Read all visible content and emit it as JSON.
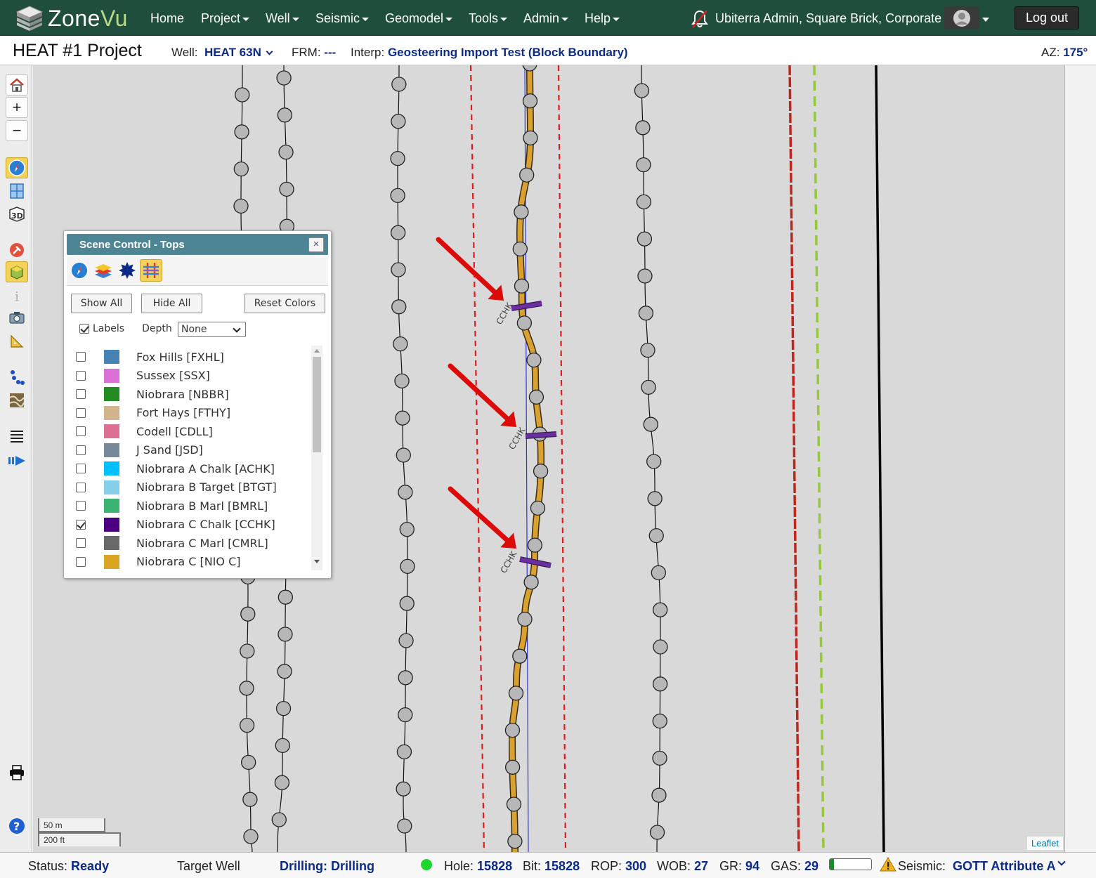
{
  "app": {
    "brand_zone": "Zone",
    "brand_vu": "Vu"
  },
  "nav": {
    "items": [
      {
        "label": "Home",
        "caret": false
      },
      {
        "label": "Project",
        "caret": true
      },
      {
        "label": "Well",
        "caret": true
      },
      {
        "label": "Seismic",
        "caret": true
      },
      {
        "label": "Geomodel",
        "caret": true
      },
      {
        "label": "Tools",
        "caret": true
      },
      {
        "label": "Admin",
        "caret": true
      },
      {
        "label": "Help",
        "caret": true
      }
    ],
    "user": "Ubiterra Admin, Square Brick, Corporate",
    "logout": "Log out"
  },
  "project": {
    "title": "HEAT #1 Project",
    "well_label": "Well:",
    "well_value": "HEAT 63N",
    "frm_label": "FRM:",
    "frm_value": "---",
    "interp_label": "Interp:",
    "interp_value": "Geosteering Import Test (Block Boundary)",
    "az_label": "AZ:",
    "az_value": "175°"
  },
  "scene_control": {
    "title": "Scene Control - Tops",
    "close_glyph": "×",
    "show_all": "Show All",
    "hide_all": "Hide All",
    "reset_colors": "Reset Colors",
    "labels_text": "Labels",
    "labels_checked": true,
    "depth_label": "Depth",
    "depth_value": "None",
    "tops": [
      {
        "name": "Fox Hills [FXHL]",
        "color": "#4682b4",
        "checked": false
      },
      {
        "name": "Sussex [SSX]",
        "color": "#da70d6",
        "checked": false
      },
      {
        "name": "Niobrara [NBBR]",
        "color": "#228b22",
        "checked": false
      },
      {
        "name": "Fort Hays [FTHY]",
        "color": "#d2b48c",
        "checked": false
      },
      {
        "name": "Codell [CDLL]",
        "color": "#db7093",
        "checked": false
      },
      {
        "name": "J Sand [JSD]",
        "color": "#778899",
        "checked": false
      },
      {
        "name": "Niobrara A Chalk [ACHK]",
        "color": "#00bfff",
        "checked": false
      },
      {
        "name": "Niobrara B Target [BTGT]",
        "color": "#87ceeb",
        "checked": false
      },
      {
        "name": "Niobrara B Marl [BMRL]",
        "color": "#3cb371",
        "checked": false
      },
      {
        "name": "Niobrara C Chalk [CCHK]",
        "color": "#4b0082",
        "checked": true
      },
      {
        "name": "Niobrara C Marl [CMRL]",
        "color": "#696969",
        "checked": false
      },
      {
        "name": "Niobrara C [NIO C]",
        "color": "#daa520",
        "checked": false
      }
    ]
  },
  "map": {
    "top_label": "CCHK",
    "pick_color": "#6a2f9e",
    "wellbore_color": "#d9a230",
    "arrow_color": "#dd0a0a",
    "scale_m": "50 m",
    "scale_ft": "200 ft",
    "attribution": "Leaflet"
  },
  "status": {
    "status_label": "Status:",
    "status_value": "Ready",
    "target_well": "Target Well",
    "drilling": "Drilling: Drilling",
    "hole_label": "Hole:",
    "hole_value": "15828",
    "bit_label": "Bit:",
    "bit_value": "15828",
    "rop_label": "ROP:",
    "rop_value": "300",
    "wob_label": "WOB:",
    "wob_value": "27",
    "gr_label": "GR:",
    "gr_value": "94",
    "gas_label": "GAS:",
    "gas_value": "29",
    "gas_level": 0.1,
    "seismic_label": "Seismic:",
    "seismic_value": "GOTT Attribute A"
  }
}
